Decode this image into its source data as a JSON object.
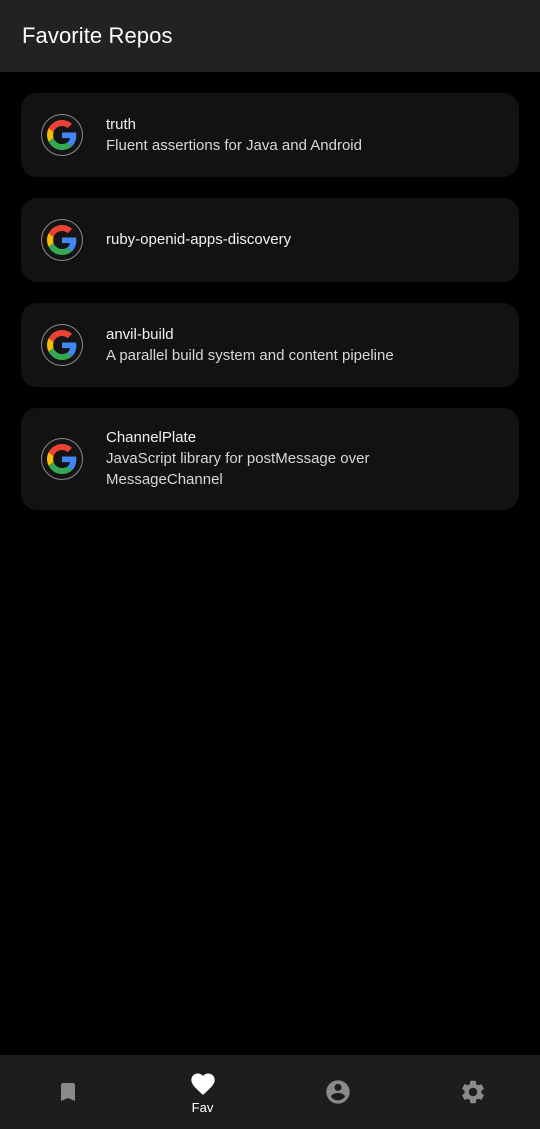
{
  "header": {
    "title": "Favorite Repos"
  },
  "repos": [
    {
      "name": "truth",
      "description": "Fluent assertions for Java and Android",
      "avatar_icon": "google-logo-icon"
    },
    {
      "name": "ruby-openid-apps-discovery",
      "description": "",
      "avatar_icon": "google-logo-icon"
    },
    {
      "name": "anvil-build",
      "description": "A parallel build system and content pipeline",
      "avatar_icon": "google-logo-icon"
    },
    {
      "name": "ChannelPlate",
      "description": "JavaScript library for postMessage over MessageChannel",
      "avatar_icon": "google-logo-icon"
    }
  ],
  "bottom_nav": {
    "items": [
      {
        "icon": "bookmark-icon",
        "label": ""
      },
      {
        "icon": "heart-icon",
        "label": "Fav",
        "selected": true
      },
      {
        "icon": "account-icon",
        "label": ""
      },
      {
        "icon": "settings-icon",
        "label": ""
      }
    ]
  },
  "colors": {
    "background": "#000000",
    "topbar": "#222222",
    "card": "#121212",
    "bottom_nav": "#1d1d1d",
    "google_blue": "#4285F4",
    "google_red": "#EA4335",
    "google_yellow": "#FBBC05",
    "google_green": "#34A853",
    "nav_icon_inactive": "#8a8a8a",
    "nav_icon_active": "#ffffff"
  }
}
